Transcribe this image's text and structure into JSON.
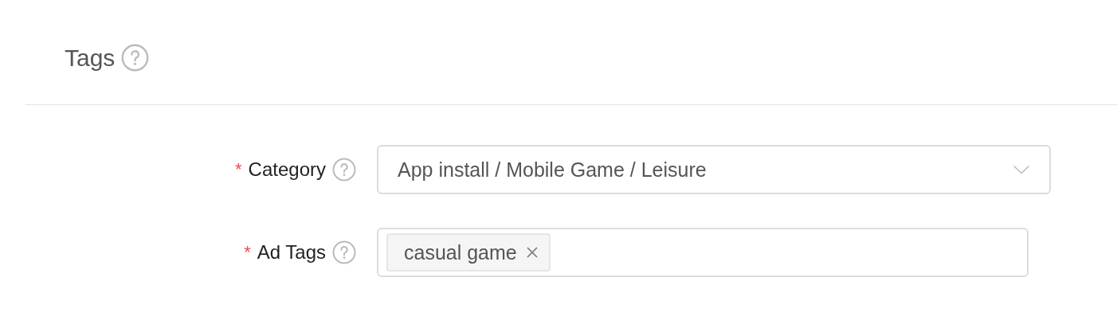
{
  "section": {
    "title": "Tags"
  },
  "fields": [
    {
      "kind": "select",
      "required_mark": "*",
      "label": "Category",
      "value": "App install / Mobile Game / Leisure"
    },
    {
      "kind": "tags",
      "required_mark": "*",
      "label": "Ad Tags",
      "tags": [
        {
          "label": "casual game"
        }
      ]
    }
  ]
}
